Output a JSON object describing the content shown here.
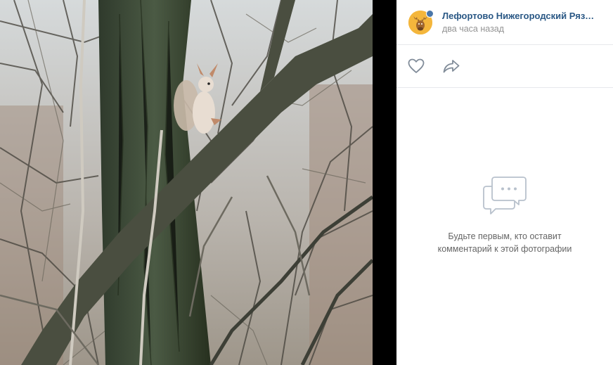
{
  "post": {
    "author_name": "Лефортово Нижегородский Рязан...",
    "time": "два часа назад"
  },
  "actions": {
    "like_icon": "heart-icon",
    "share_icon": "share-arrow-icon"
  },
  "comments": {
    "empty_icon": "comments-bubble-icon",
    "empty_line1": "Будьте первым, кто оставит",
    "empty_line2": "комментарий к этой фотографии"
  },
  "colors": {
    "link": "#2a5885",
    "muted": "#939393",
    "icon": "#818c99",
    "verified": "#4a76a8"
  }
}
